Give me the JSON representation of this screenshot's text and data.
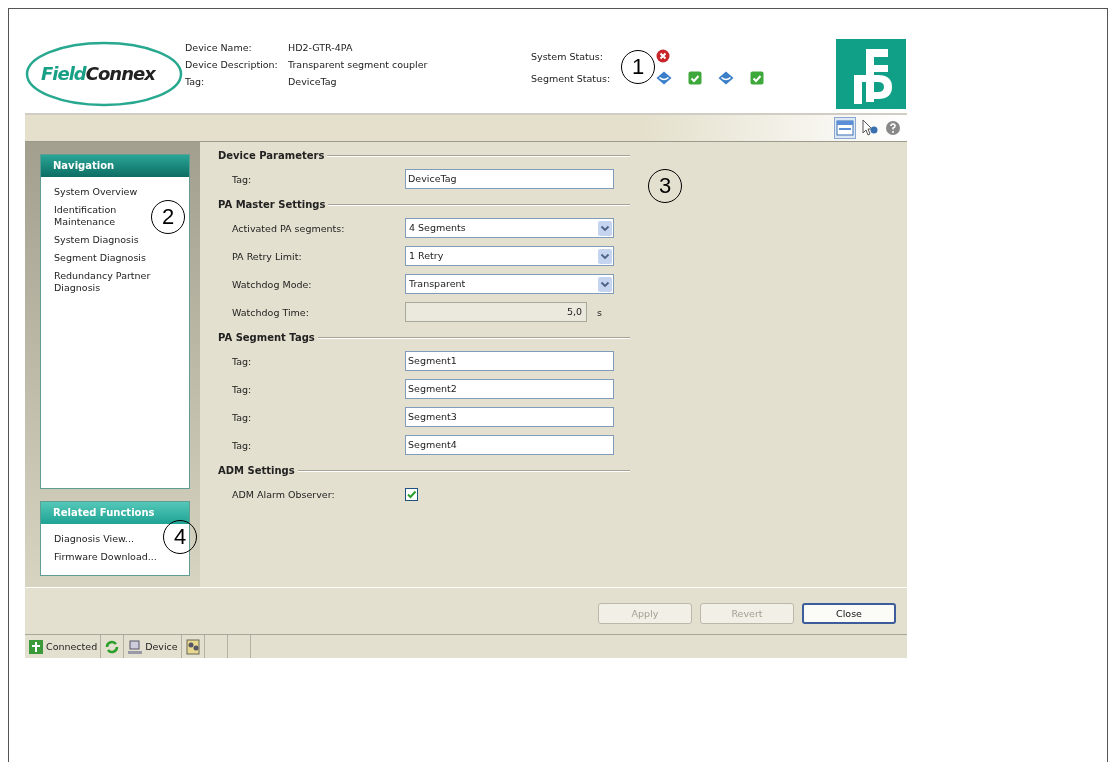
{
  "header": {
    "logo": {
      "part_1": "Field",
      "part_2": "Connex"
    },
    "device_info": [
      {
        "label": "Device Name:",
        "value": "HD2-GTR-4PA"
      },
      {
        "label": "Device Description:",
        "value": "Transparent segment coupler"
      },
      {
        "label": "Tag:",
        "value": "DeviceTag"
      }
    ],
    "system_status": {
      "label": "System Status:",
      "icons": [
        {
          "kind": "error"
        }
      ]
    },
    "segment_status": {
      "label": "Segment Status:",
      "icons": [
        {
          "kind": "diamond"
        },
        {
          "kind": "ok"
        },
        {
          "kind": "diamond"
        },
        {
          "kind": "ok"
        }
      ]
    }
  },
  "toolbar": [
    {
      "kind": "window",
      "selected": true
    },
    {
      "kind": "pointer",
      "selected": false
    },
    {
      "kind": "help",
      "selected": false
    }
  ],
  "navigation": {
    "title": "Navigation",
    "items": [
      "System Overview",
      "Identification Maintenance",
      "System Diagnosis",
      "Segment Diagnosis",
      "Redundancy Partner Diagnosis"
    ]
  },
  "related_functions": {
    "title": "Related Functions",
    "items": [
      "Diagnosis View...",
      "Firmware Download..."
    ]
  },
  "sections": [
    {
      "title": "Device Parameters",
      "rows": [
        {
          "kind": "text",
          "label": "Tag:",
          "value": "DeviceTag"
        }
      ]
    },
    {
      "title": "PA Master Settings",
      "rows": [
        {
          "kind": "dropdown",
          "label": "Activated PA segments:",
          "value": "4 Segments"
        },
        {
          "kind": "dropdown",
          "label": "PA Retry Limit:",
          "value": "1 Retry"
        },
        {
          "kind": "dropdown",
          "label": "Watchdog Mode:",
          "value": "Transparent"
        },
        {
          "kind": "readonly",
          "label": "Watchdog Time:",
          "value": "5,0",
          "unit": "s"
        }
      ]
    },
    {
      "title": "PA Segment Tags",
      "rows": [
        {
          "kind": "text",
          "label": "Tag:",
          "value": "Segment1"
        },
        {
          "kind": "text",
          "label": "Tag:",
          "value": "Segment2"
        },
        {
          "kind": "text",
          "label": "Tag:",
          "value": "Segment3"
        },
        {
          "kind": "text",
          "label": "Tag:",
          "value": "Segment4"
        }
      ]
    },
    {
      "title": "ADM Settings",
      "rows": [
        {
          "kind": "checkbox",
          "label": "ADM Alarm Observer:",
          "checked": true
        }
      ]
    }
  ],
  "buttons": [
    {
      "label": "Apply",
      "disabled": true
    },
    {
      "label": "Revert",
      "disabled": true
    },
    {
      "label": "Close",
      "disabled": false
    }
  ],
  "status_bar": [
    {
      "kind": "connected",
      "text": "Connected"
    },
    {
      "kind": "refresh"
    },
    {
      "kind": "device",
      "text": "Device"
    },
    {
      "kind": "users"
    }
  ],
  "callouts": [
    {
      "text": "1"
    },
    {
      "text": "2"
    },
    {
      "text": "3"
    },
    {
      "text": "4"
    }
  ]
}
